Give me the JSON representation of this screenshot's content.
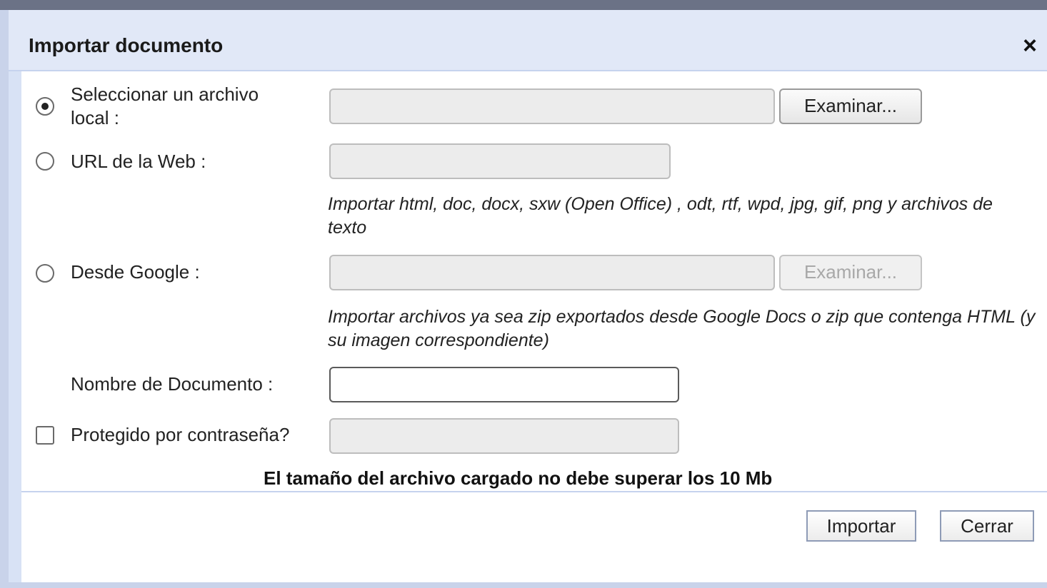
{
  "dialog": {
    "title": "Importar documento",
    "close_glyph": "×"
  },
  "options": {
    "local_file": {
      "label": "Seleccionar un archivo local :",
      "selected": true,
      "value": "",
      "browse_label": "Examinar..."
    },
    "web_url": {
      "label": "URL de la Web :",
      "selected": false,
      "value": "",
      "hint": "Importar html, doc, docx, sxw (Open Office) , odt, rtf, wpd, jpg, gif, png y archivos de texto"
    },
    "google": {
      "label": "Desde Google :",
      "selected": false,
      "value": "",
      "browse_label": "Examinar...",
      "browse_disabled": true,
      "hint": "Importar archivos ya sea zip exportados desde Google Docs o zip que contenga HTML (y su imagen correspondiente)"
    }
  },
  "document_name": {
    "label": "Nombre de Documento :",
    "value": ""
  },
  "password": {
    "label": "Protegido por contraseña?",
    "checked": false,
    "value": ""
  },
  "size_note": "El tamaño del archivo cargado no debe superar los 10 Mb",
  "footer": {
    "import_label": "Importar",
    "close_label": "Cerrar"
  },
  "icons": {
    "close": "close-icon"
  }
}
